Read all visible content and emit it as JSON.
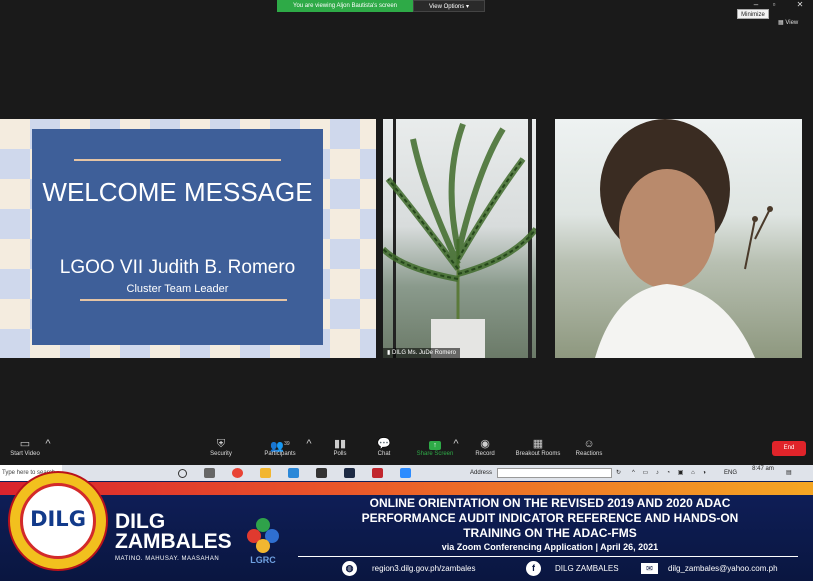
{
  "zoom": {
    "share_banner": "You are viewing Aljon Bautista's screen",
    "view_options": "View Options",
    "minimize_tooltip": "Minimize",
    "view_button": "View",
    "participant_label": "DILG Ms. JuDe Romero",
    "participants_count": "39",
    "toolbar": {
      "start_video": "Start Video",
      "security": "Security",
      "participants": "Participants",
      "polls": "Polls",
      "chat": "Chat",
      "share_screen": "Share Screen",
      "record": "Record",
      "breakout_rooms": "Breakout Rooms",
      "reactions": "Reactions",
      "end": "End"
    }
  },
  "slide": {
    "title": "WELCOME MESSAGE",
    "name": "LGOO VII Judith B. Romero",
    "role": "Cluster Team Leader"
  },
  "taskbar": {
    "search_placeholder": "Type here to search",
    "address_label": "Address",
    "language": "ENG",
    "time": "8:47 am"
  },
  "banner": {
    "logo_text": "DILG",
    "brand_line1": "DILG",
    "brand_line2": "ZAMBALES",
    "motto": "MATINO. MAHUSAY. MAASAHAN",
    "lgrc_logo_text": "LGRC",
    "title_line1": "ONLINE ORIENTATION ON THE REVISED 2019 AND 2020 ADAC",
    "title_line2": "PERFORMANCE AUDIT INDICATOR REFERENCE AND HANDS-ON",
    "title_line3": "TRAINING ON THE ADAC-FMS",
    "subtitle": "via Zoom Conferencing Application | April 26, 2021",
    "website": "region3.dilg.gov.ph/zambales",
    "facebook": "DILG ZAMBALES",
    "email": "dilg_zambales@yahoo.com.ph"
  },
  "colors": {
    "share_green": "#2eaa47",
    "end_red": "#e0242a",
    "slide_blue": "#3e5f99",
    "banner_navy": "#0a1640"
  }
}
